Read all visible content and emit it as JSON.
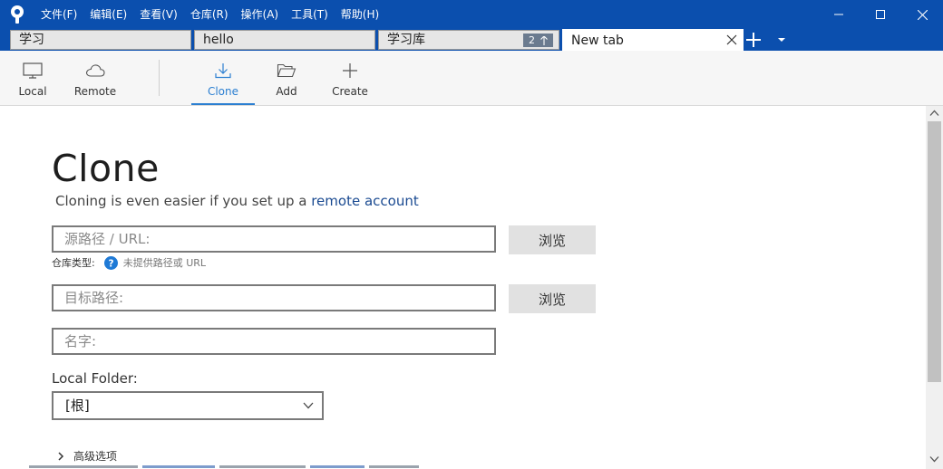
{
  "menu": [
    "文件(F)",
    "编辑(E)",
    "查看(V)",
    "仓库(R)",
    "操作(A)",
    "工具(T)",
    "帮助(H)"
  ],
  "tabs": [
    {
      "label": "学习"
    },
    {
      "label": "hello"
    },
    {
      "label": "学习库",
      "badge": "2",
      "badge_icon": "arrow-up-icon"
    },
    {
      "label": "New tab"
    }
  ],
  "toolbar": {
    "local": "Local",
    "remote": "Remote",
    "clone": "Clone",
    "add": "Add",
    "create": "Create",
    "active": "Clone"
  },
  "clone": {
    "title": "Clone",
    "subtitle_prefix": "Cloning is even easier if you set up a ",
    "subtitle_link": "remote account",
    "source_placeholder": "源路径 / URL:",
    "browse_label": "浏览",
    "repo_type_label": "仓库类型:",
    "repo_type_hint": "未提供路径或 URL",
    "dest_placeholder": "目标路径:",
    "browse_label_2": "浏览",
    "name_placeholder": "名字:",
    "local_folder_label": "Local Folder:",
    "local_folder_value": "[根]",
    "advanced_label": "高级选项"
  },
  "colors": {
    "titlebar": "#0b4fae",
    "accent": "#2b7fd1",
    "link": "#1a4a91",
    "help_icon": "#1f7ad6"
  }
}
